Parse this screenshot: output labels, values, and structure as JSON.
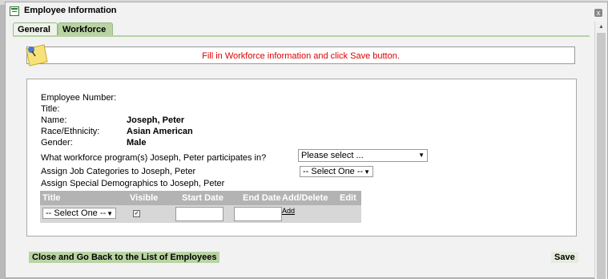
{
  "window": {
    "title": "Employee Information",
    "close_glyph": "x"
  },
  "tabs": [
    {
      "label": "General"
    },
    {
      "label": "Workforce"
    }
  ],
  "notice": {
    "text": "Fill in Workforce information and click Save button."
  },
  "employee": {
    "number_label": "Employee Number:",
    "number_value": "",
    "title_label": "Title:",
    "title_value": "",
    "name_label": "Name:",
    "name_value": "Joseph, Peter",
    "race_label": "Race/Ethnicity:",
    "race_value": "Asian American",
    "gender_label": "Gender:",
    "gender_value": "Male"
  },
  "program": {
    "question": "What workforce program(s) Joseph, Peter participates in?",
    "select_value": "Please select ..."
  },
  "job_categories": {
    "label": "Assign Job Categories to Joseph, Peter",
    "select_value": "-- Select One --"
  },
  "demographics": {
    "label": "Assign Special Demographics to Joseph, Peter",
    "columns": [
      "Title",
      "Visible",
      "Start Date",
      "End Date",
      "Add/Delete",
      "Edit"
    ],
    "row": {
      "title_select": "-- Select One --",
      "visible_checked": true,
      "start_date": "",
      "end_date": "",
      "add_link": "Add"
    }
  },
  "footer": {
    "back_button": "Close and Go Back to the List of Employees",
    "save_button": "Save"
  },
  "colors": {
    "tab_active": "#b9d3a4",
    "notice_text": "#dd0000",
    "grid_header": "#b3b3b3"
  }
}
